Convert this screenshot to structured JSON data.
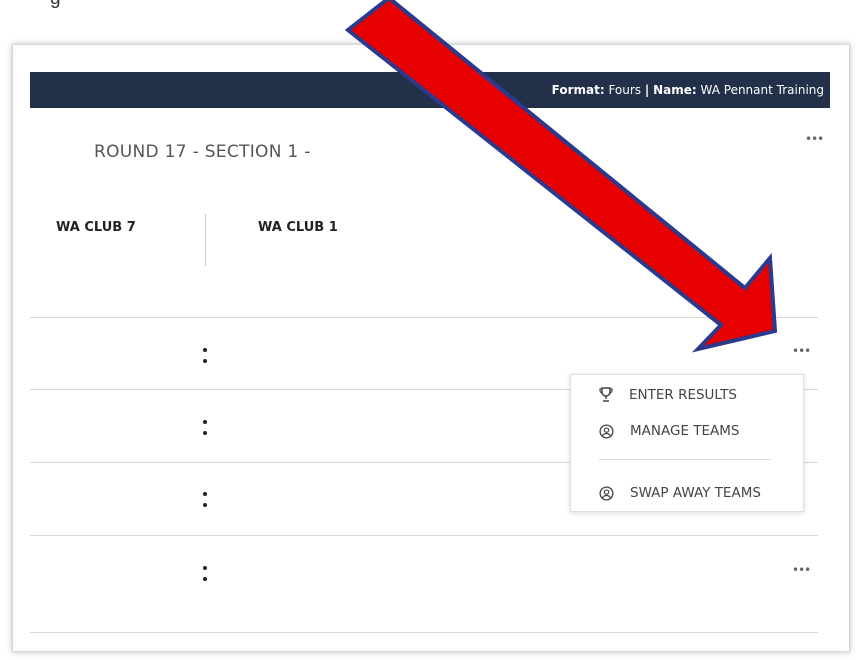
{
  "caption": {
    "text": "g"
  },
  "header": {
    "format_label": "Format:",
    "format_value": "Fours",
    "separator": "|",
    "name_label": "Name:",
    "name_value": "WA Pennant Training",
    "background": "#22304a"
  },
  "round": {
    "title": "ROUND 17 - SECTION 1 -",
    "menu_icon": "ellipsis-icon"
  },
  "teams": {
    "home": "WA CLUB 7",
    "away": "WA CLUB 1"
  },
  "rinks": {
    "count_shown": 4,
    "score_icon": "colon-icon",
    "menu_icon": "ellipsis-icon"
  },
  "context_menu": {
    "items": [
      {
        "label": "ENTER RESULTS",
        "icon": "trophy-icon"
      },
      {
        "label": "MANAGE TEAMS",
        "icon": "user-circle-icon"
      },
      {
        "label": "SWAP AWAY TEAMS",
        "icon": "user-circle-icon"
      }
    ]
  },
  "annotation": {
    "icon": "red-arrow-icon",
    "color": "#e60000",
    "outline": "#2b3a8c"
  }
}
